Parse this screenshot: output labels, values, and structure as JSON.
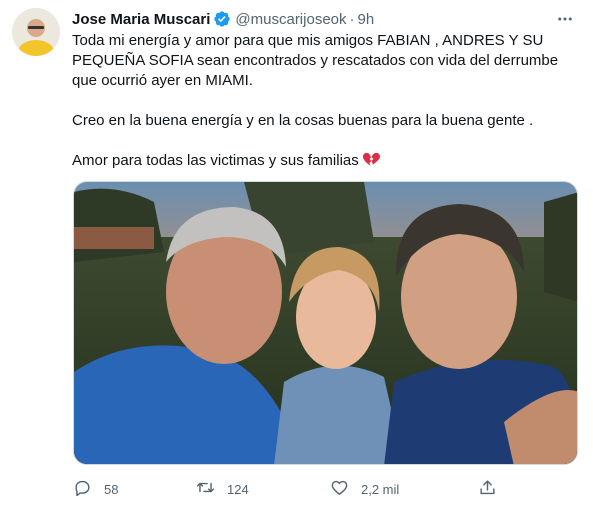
{
  "user": {
    "name": "Jose Maria Muscari",
    "handle": "@muscarijoseok",
    "separator": "·",
    "time": "9h"
  },
  "tweet": {
    "paragraph1": "Toda mi energía y amor para que mis amigos FABIAN , ANDRES Y SU PEQUEÑA SOFIA sean encontrados y rescatados con vida del derrumbe que ocurrió ayer en MIAMI.",
    "paragraph2": "Creo en la buena energía y en la cosas buenas para la buena gente .",
    "paragraph3": "Amor para todas las victimas y sus familias",
    "emoji": "broken-heart"
  },
  "actions": {
    "replies": "58",
    "retweets": "124",
    "likes": "2,2 mil"
  },
  "icons": {
    "verified": "verified-badge-icon",
    "more": "more-options-icon",
    "reply": "reply-icon",
    "retweet": "retweet-icon",
    "like": "heart-icon",
    "share": "share-icon"
  },
  "colors": {
    "verified": "#1d9bf0",
    "muted": "#536471",
    "emoji": "#dd2e44"
  }
}
